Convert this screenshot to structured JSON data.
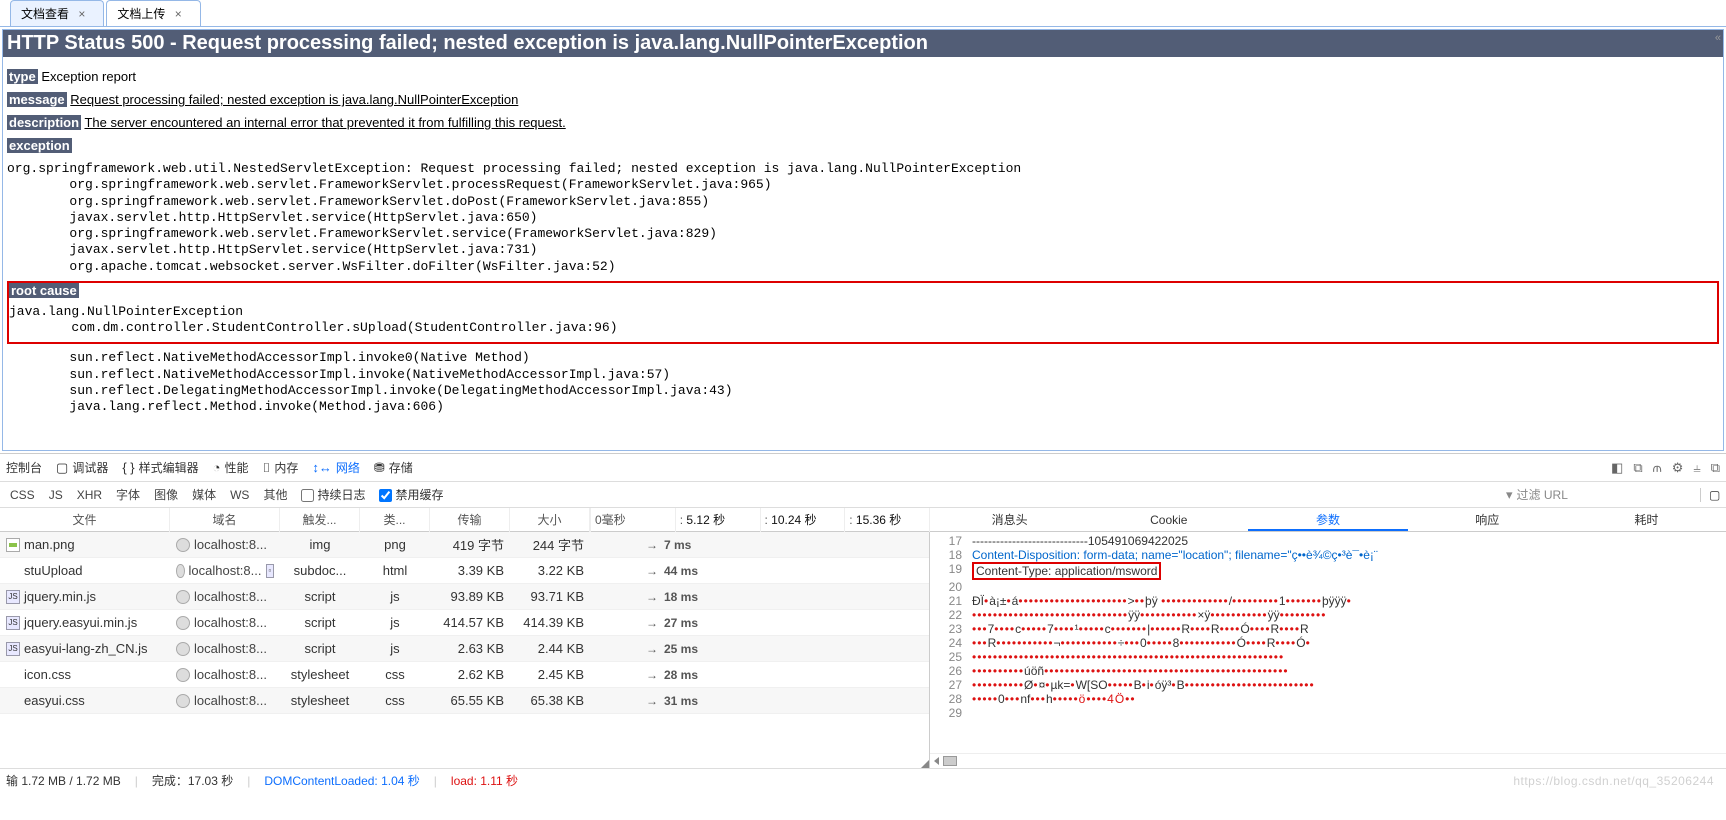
{
  "tabs": [
    {
      "label": "文档查看",
      "active": false
    },
    {
      "label": "文档上传",
      "active": true
    }
  ],
  "error": {
    "title": "HTTP Status 500 - Request processing failed; nested exception is java.lang.NullPointerException",
    "type_label": "type",
    "type_value": "Exception report",
    "message_label": "message",
    "message_value": "Request processing failed; nested exception is java.lang.NullPointerException",
    "description_label": "description",
    "description_value": "The server encountered an internal error that prevented it from fulfilling this request.",
    "exception_label": "exception",
    "exception_stack": "org.springframework.web.util.NestedServletException: Request processing failed; nested exception is java.lang.NullPointerException\n        org.springframework.web.servlet.FrameworkServlet.processRequest(FrameworkServlet.java:965)\n        org.springframework.web.servlet.FrameworkServlet.doPost(FrameworkServlet.java:855)\n        javax.servlet.http.HttpServlet.service(HttpServlet.java:650)\n        org.springframework.web.servlet.FrameworkServlet.service(FrameworkServlet.java:829)\n        javax.servlet.http.HttpServlet.service(HttpServlet.java:731)\n        org.apache.tomcat.websocket.server.WsFilter.doFilter(WsFilter.java:52)",
    "rootcause_label": "root cause",
    "rootcause_stack_hl": "java.lang.NullPointerException\n        com.dm.controller.StudentController.sUpload(StudentController.java:96)",
    "rootcause_stack_rest": "        sun.reflect.NativeMethodAccessorImpl.invoke0(Native Method)\n        sun.reflect.NativeMethodAccessorImpl.invoke(NativeMethodAccessorImpl.java:57)\n        sun.reflect.DelegatingMethodAccessorImpl.invoke(DelegatingMethodAccessorImpl.java:43)\n        java.lang.reflect.Method.invoke(Method.java:606)"
  },
  "devtools": {
    "tabs1": {
      "console": "控制台",
      "debugger": "调试器",
      "style": "样式编辑器",
      "perf": "性能",
      "memory": "内存",
      "network": "网络",
      "storage": "存储"
    },
    "tabs2": {
      "css": "CSS",
      "js": "JS",
      "xhr": "XHR",
      "font": "字体",
      "img": "图像",
      "media": "媒体",
      "ws": "WS",
      "other": "其他",
      "persist": "持续日志",
      "disable_cache": "禁用缓存",
      "filter_placeholder": "过滤 URL"
    },
    "net_head": {
      "file": "文件",
      "domain": "域名",
      "cause": "触发...",
      "type": "类...",
      "transfer": "传输",
      "size": "大小"
    },
    "timeline": {
      "t0": "0毫秒",
      "t1": "5.12 秒",
      "t2": "10.24 秒",
      "t3": "15.36 秒"
    },
    "rows": [
      {
        "file": "man.png",
        "domain": "localhost:8...",
        "cause": "img",
        "type": "png",
        "transfer": "419 字节",
        "size": "244 字节",
        "time": "7 ms"
      },
      {
        "file": "stuUpload",
        "domain": "localhost:8...",
        "cause": "subdoc...",
        "type": "html",
        "transfer": "3.39 KB",
        "size": "3.22 KB",
        "time": "44 ms",
        "hasSub": true
      },
      {
        "file": "jquery.min.js",
        "domain": "localhost:8...",
        "cause": "script",
        "type": "js",
        "transfer": "93.89 KB",
        "size": "93.71 KB",
        "time": "18 ms"
      },
      {
        "file": "jquery.easyui.min.js",
        "domain": "localhost:8...",
        "cause": "script",
        "type": "js",
        "transfer": "414.57 KB",
        "size": "414.39 KB",
        "time": "27 ms"
      },
      {
        "file": "easyui-lang-zh_CN.js",
        "domain": "localhost:8...",
        "cause": "script",
        "type": "js",
        "transfer": "2.63 KB",
        "size": "2.44 KB",
        "time": "25 ms"
      },
      {
        "file": "icon.css",
        "domain": "localhost:8...",
        "cause": "stylesheet",
        "type": "css",
        "transfer": "2.62 KB",
        "size": "2.45 KB",
        "time": "28 ms"
      },
      {
        "file": "easyui.css",
        "domain": "localhost:8...",
        "cause": "stylesheet",
        "type": "css",
        "transfer": "65.55 KB",
        "size": "65.38 KB",
        "time": "31 ms"
      }
    ],
    "detail_tabs": {
      "headers": "消息头",
      "cookie": "Cookie",
      "params": "参数",
      "response": "响应",
      "timing": "耗时"
    },
    "params_lines": [
      {
        "n": 17,
        "t": "-----------------------------105491069422025"
      },
      {
        "n": 18,
        "t": "Content-Disposition: form-data; name=\"location\"; filename=\"ç••è¾©ç•³è¯•è¡¨"
      },
      {
        "n": 19,
        "t": "Content-Type: application/msword",
        "hl": true
      },
      {
        "n": 20,
        "t": ""
      },
      {
        "n": 21,
        "t": "ÐÏ•à¡±•á•••••••••••••••••••••>••þÿ                •••••••••••••/•••••••••1•••••••þÿÿÿ•"
      },
      {
        "n": 22,
        "t": "••••••••••••••••••••••••••••••ÿÿ•••••••••••×ÿ•••••••••••ÿÿ•••••••••"
      },
      {
        "n": 23,
        "t": "•••7••••c•••••7••••¹•••••c•••••••|••••••R••••R••••Ó••••R••••R"
      },
      {
        "n": 24,
        "t": "•••R•••••••••••¬•••••••••••÷•••0•••••8•••••••••••Ó••••R••••Ó•"
      },
      {
        "n": 25,
        "t": "••••••••••••••••••••••••••••••••••••••••••••••••••••••••••••"
      },
      {
        "n": 26,
        "t": "••••••••••úöñ•••••••••••••••••••••••••••••••••••••••••••••••"
      },
      {
        "n": 27,
        "t": "••••••••••Ø•¤•µk=•W[SO•••••B•i•óÿ³•B•••••••••••••••••••••••••"
      },
      {
        "n": 28,
        "t": "•••••0•••nf•••h•<h••••ö••••4Ö••"
      },
      {
        "n": 29,
        "t": ""
      }
    ],
    "status": {
      "transferred": "输 1.72 MB / 1.72 MB",
      "finish": "完成：17.03 秒",
      "dom": "DOMContentLoaded: 1.04 秒",
      "load": "load: 1.11 秒"
    },
    "watermark": "https://blog.csdn.net/qq_35206244"
  }
}
